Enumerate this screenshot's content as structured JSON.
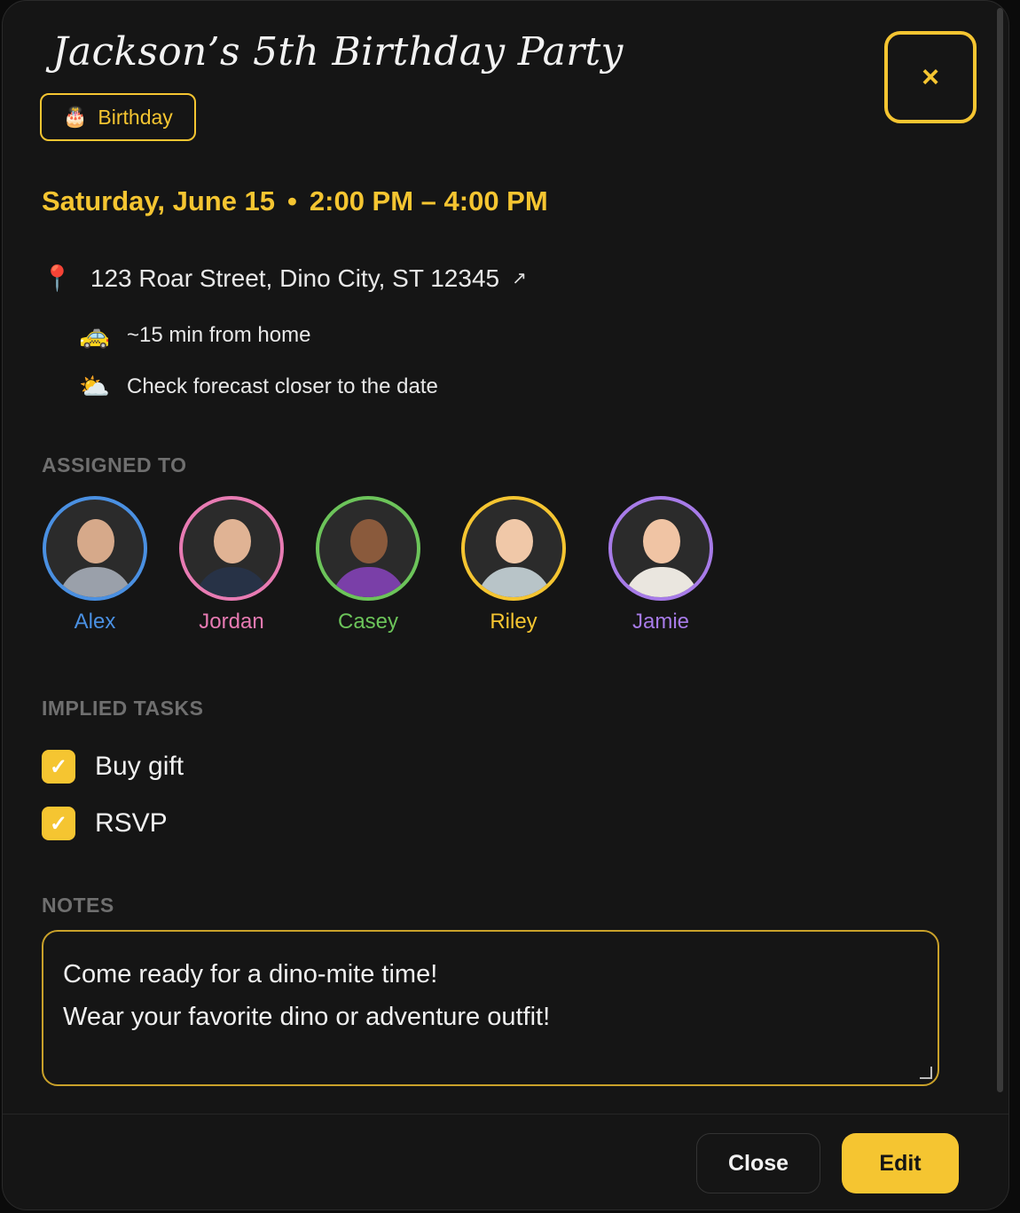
{
  "event": {
    "title": "Jackson’s 5th Birthday Party",
    "category": "Birthday",
    "category_icon": "cake-icon",
    "date": "Saturday, June 15",
    "separator": "•",
    "time": "2:00 PM – 4:00 PM",
    "address": "123 Roar Street, Dino City, ST 12345",
    "address_link_icon": "↗",
    "drive_time": "~15 min from home",
    "weather": "Check forecast closer to the date"
  },
  "close_icon": "×",
  "assigned": {
    "label": "ASSIGNED TO",
    "people": [
      {
        "name": "Alex",
        "color": "#4a90e2"
      },
      {
        "name": "Jordan",
        "color": "#e87bb3"
      },
      {
        "name": "Casey",
        "color": "#6cc45a"
      },
      {
        "name": "Riley",
        "color": "#f5c531"
      },
      {
        "name": "Jamie",
        "color": "#a77be8"
      }
    ]
  },
  "tasks": {
    "label": "IMPLIED TASKS",
    "items": [
      {
        "label": "Buy gift",
        "checked": true
      },
      {
        "label": "RSVP",
        "checked": true
      }
    ]
  },
  "notes": {
    "label": "NOTES",
    "line1": "Come ready for a dino-mite time!",
    "line2": "Wear your favorite dino or adventure outfit!"
  },
  "footer": {
    "close_label": "Close",
    "edit_label": "Edit"
  },
  "colors": {
    "accent": "#f5c531",
    "background": "#151515"
  }
}
